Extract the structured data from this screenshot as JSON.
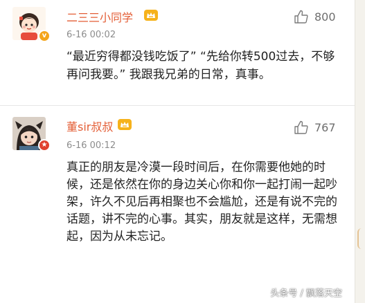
{
  "comments": [
    {
      "username": "二三三小同学",
      "time": "6-16 00:02",
      "likes": "800",
      "text": "“最近穷得都没钱吃饭了” “先给你转500过去，不够再问我要。” 我跟我兄弟的日常，真事。",
      "badge_color": "#f4a51c",
      "avatar": "cartoon-girl-avatar"
    },
    {
      "username": "董sir叔叔",
      "time": "6-16 00:12",
      "likes": "767",
      "text": "真正的朋友是冷漠一段时间后，在你需要他她的时候，还是依然在你的身边关心你和你一起打闹一起吵架，许久不见后再相聚也不会尴尬，还是有说不完的话题，讲不完的心事。其实，朋友就是这样，无需想起，因为从未忘记。",
      "badge_color": "#e0412f",
      "avatar": "child-photo-avatar"
    }
  ],
  "watermark": "头条号 / 飘落天空",
  "colors": {
    "username": "#e35d35",
    "vip": "#f6b21b",
    "meta": "#8c8c8c"
  }
}
